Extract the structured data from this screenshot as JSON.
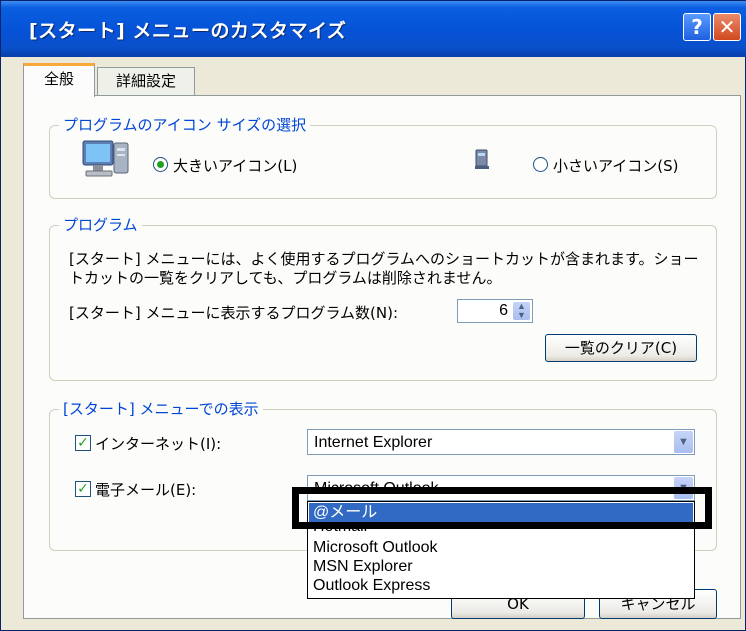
{
  "window": {
    "title": "[スタート] メニューのカスタマイズ",
    "help_glyph": "?",
    "close_glyph": "✕"
  },
  "tabs": [
    {
      "label": "全般",
      "active": true
    },
    {
      "label": "詳細設定",
      "active": false
    }
  ],
  "icon_size": {
    "legend": "プログラムのアイコン サイズの選択",
    "large_label": "大きいアイコン(L)",
    "small_label": "小さいアイコン(S)",
    "selected": "large"
  },
  "programs": {
    "legend": "プログラム",
    "description_line1": "[スタート] メニューには、よく使用するプログラムへのショートカットが含まれます。ショー",
    "description_line2": "トカットの一覧をクリアしても、プログラムは削除されません。",
    "count_label": "[スタート] メニューに表示するプログラム数(N):",
    "count_value": "6",
    "clear_button": "一覧のクリア(C)"
  },
  "show_on_start": {
    "legend": "[スタート] メニューでの表示",
    "internet_label": "インターネット(I):",
    "internet_checked": true,
    "internet_value": "Internet Explorer",
    "email_label": "電子メール(E):",
    "email_checked": true,
    "email_value": "Microsoft Outlook"
  },
  "email_dropdown": {
    "options": [
      "@メール",
      "Hotmail",
      "Microsoft Outlook",
      "MSN Explorer",
      "Outlook Express"
    ],
    "highlighted_index": 0
  },
  "footer": {
    "ok_button": "OK",
    "cancel_button": "キャンセル"
  },
  "colors": {
    "title_bar": "#0653d8",
    "group_label": "#0046d5",
    "selection": "#316ac5",
    "tab_accent": "#f7a93c"
  }
}
